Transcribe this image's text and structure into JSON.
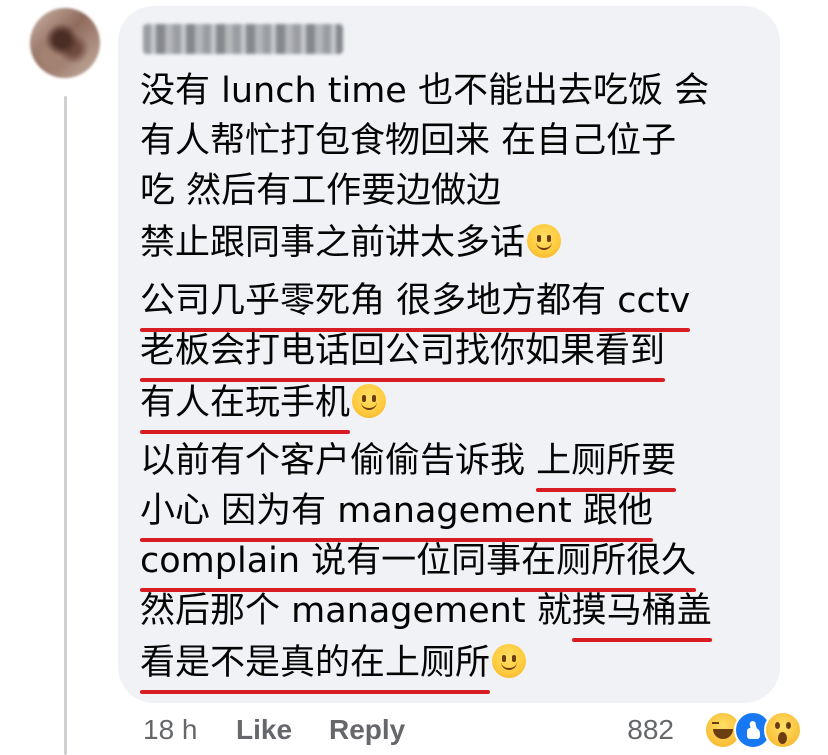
{
  "comment": {
    "author": "",
    "lines": [
      {
        "plain": "没有 lunch time 也不能出去吃饭 会"
      },
      {
        "plain": "有人帮忙打包食物回来 在自己位子"
      },
      {
        "plain": "吃 然后有工作要边做边"
      },
      {
        "plain": "禁止跟同事之前讲太多话"
      },
      {
        "underlined": "公司几乎零死角 很多地方都有 cctv"
      },
      {
        "underlined": "老板会打电话回公司找你如果看到"
      },
      {
        "underlined": "有人在玩手机"
      },
      {
        "plain": "以前有个客户偷偷告诉我 ",
        "underlined": "上厕所要"
      },
      {
        "underlined": "小心 因为有 management 跟他"
      },
      {
        "underlined": "complain 说有一位同事在厕所很久"
      },
      {
        "plain": "然后那个 management 就",
        "underlined": "摸马桶盖"
      },
      {
        "underlined": "看是不是真的在上厕所"
      }
    ],
    "emoji_icon": "slightly-smiling-face-icon"
  },
  "footer": {
    "time": "18 h",
    "like_label": "Like",
    "reply_label": "Reply",
    "reaction_count": "882",
    "reactions": [
      "haha-reaction-icon",
      "like-reaction-icon",
      "wow-reaction-icon"
    ]
  },
  "colors": {
    "bubble_bg": "#f0f2f5",
    "text": "#050505",
    "meta_text": "#65676b",
    "underline": "#d91c24",
    "like_blue": "#1877f2"
  }
}
